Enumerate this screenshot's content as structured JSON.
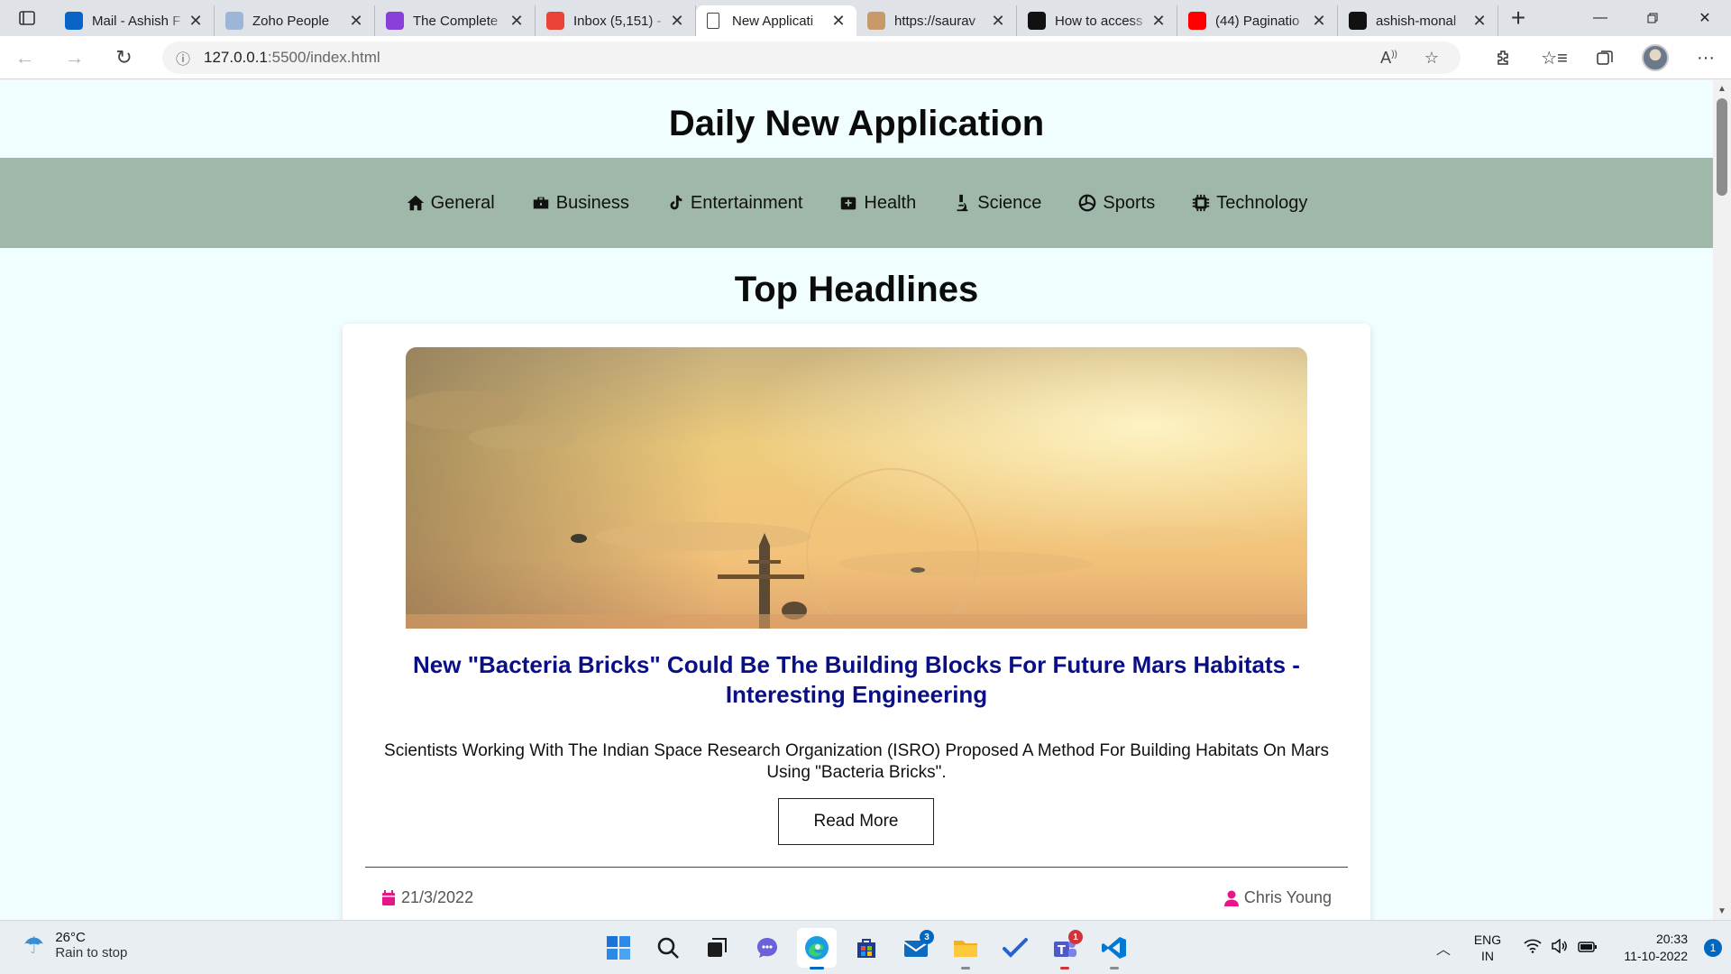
{
  "browser": {
    "tabs": [
      {
        "title": "Mail - Ashish F",
        "icon": "outlook-icon",
        "color": "#0a64c8"
      },
      {
        "title": "Zoho People",
        "icon": "zoho-icon",
        "color": "#9bb6d8"
      },
      {
        "title": "The Complete",
        "icon": "course-icon",
        "color": "#8b3fd9"
      },
      {
        "title": "Inbox (5,151) -",
        "icon": "gmail-icon",
        "color": "#ea4335"
      },
      {
        "title": "New Applicati",
        "icon": "page-icon",
        "color": "#ffffff",
        "active": true
      },
      {
        "title": "https://saurav",
        "icon": "profile-icon",
        "color": "#c89a6a"
      },
      {
        "title": "How to access",
        "icon": "eh-icon",
        "color": "#111111"
      },
      {
        "title": "(44) Paginatio",
        "icon": "youtube-icon",
        "color": "#ff0000"
      },
      {
        "title": "ashish-monal",
        "icon": "github-icon",
        "color": "#111111"
      }
    ],
    "url_host": "127.0.0.1",
    "url_path": ":5500/index.html"
  },
  "page": {
    "site_title": "Daily New Application",
    "nav": [
      {
        "label": "General",
        "icon": "house-icon"
      },
      {
        "label": "Business",
        "icon": "briefcase-icon"
      },
      {
        "label": "Entertainment",
        "icon": "music-note-icon"
      },
      {
        "label": "Health",
        "icon": "medical-kit-icon"
      },
      {
        "label": "Science",
        "icon": "microscope-icon"
      },
      {
        "label": "Sports",
        "icon": "volleyball-icon"
      },
      {
        "label": "Technology",
        "icon": "microchip-icon"
      }
    ],
    "section_title": "Top Headlines",
    "article": {
      "title": "New \"Bacteria Bricks\" Could Be The Building Blocks For Future Mars Habitats - Interesting Engineering",
      "description": "Scientists Working With The Indian Space Research Organization (ISRO) Proposed A Method For Building Habitats On Mars Using \"Bacteria Bricks\".",
      "read_more": "Read More",
      "date": "21/3/2022",
      "author": "Chris Young",
      "accent": "#e6158a"
    }
  },
  "taskbar": {
    "weather_temp": "26°C",
    "weather_desc": "Rain to stop",
    "apps": [
      {
        "name": "windows-start",
        "badge": null
      },
      {
        "name": "search",
        "badge": null
      },
      {
        "name": "task-view",
        "badge": null
      },
      {
        "name": "chat",
        "badge": null
      },
      {
        "name": "edge",
        "badge": null,
        "active": true
      },
      {
        "name": "store",
        "badge": null
      },
      {
        "name": "mail",
        "badge": "3"
      },
      {
        "name": "file-explorer",
        "badge": null
      },
      {
        "name": "todo",
        "badge": null
      },
      {
        "name": "teams",
        "badge": "1"
      },
      {
        "name": "vscode",
        "badge": null
      }
    ],
    "lang_1": "ENG",
    "lang_2": "IN",
    "time": "20:33",
    "date": "11-10-2022",
    "notifications": "1"
  }
}
